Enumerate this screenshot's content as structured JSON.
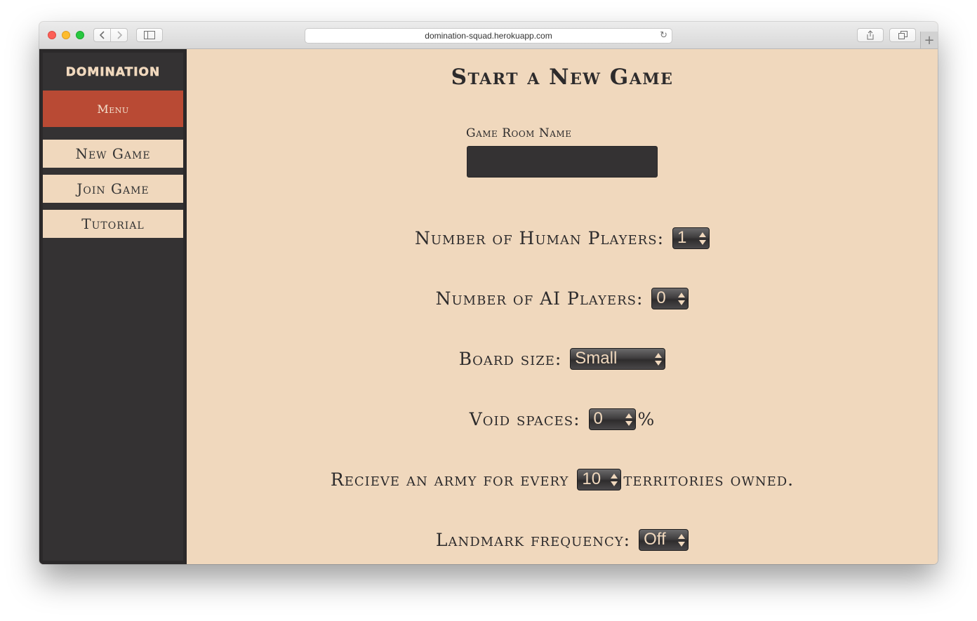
{
  "browser": {
    "url": "domination-squad.herokuapp.com",
    "back_icon": "chevron-left-icon",
    "forward_icon": "chevron-right-icon"
  },
  "sidebar": {
    "logo": "DOMINATION",
    "menu_label": "Menu",
    "items": [
      {
        "label": "New Game"
      },
      {
        "label": "Join Game"
      },
      {
        "label": "Tutorial"
      }
    ]
  },
  "main": {
    "title": "Start a New Game",
    "room_name_label": "Game Room Name",
    "room_name_value": "",
    "human_players_label": "Number of Human Players:",
    "human_players_value": "1",
    "ai_players_label": "Number of AI Players:",
    "ai_players_value": "0",
    "board_size_label": "Board size:",
    "board_size_value": "Small",
    "void_spaces_label": "Void spaces:",
    "void_spaces_value": "0",
    "void_spaces_suffix": "%",
    "army_prefix": "Recieve an army for every",
    "army_value": "10",
    "army_suffix": "territories owned.",
    "landmark_label": "Landmark frequency:",
    "landmark_value": "Off"
  },
  "colors": {
    "background": "#f0d8bd",
    "sidebar": "#343233",
    "menu_accent": "#b94a34",
    "text": "#2d2b2c"
  }
}
